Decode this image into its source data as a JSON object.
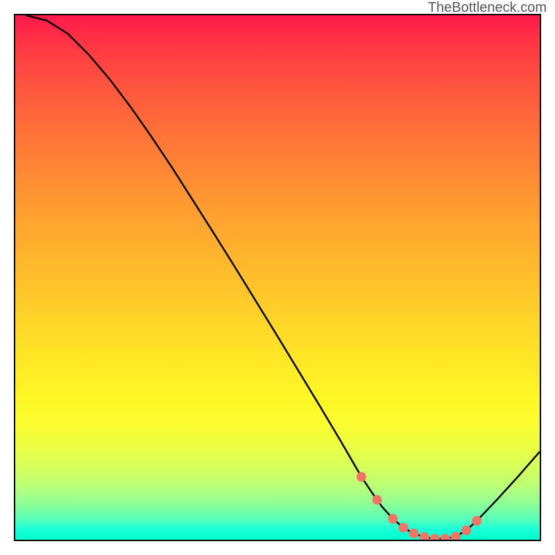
{
  "attribution": "TheBottleneck.com",
  "colors": {
    "border": "#000000",
    "line": "#000000",
    "data_point": "#f07565",
    "gradient_top": "#ff1a4d",
    "gradient_bottom": "#00ffcc"
  },
  "chart_data": {
    "type": "line",
    "title": "",
    "xlabel": "",
    "ylabel": "",
    "xlim": [
      0,
      100
    ],
    "ylim": [
      0,
      100
    ],
    "series": [
      {
        "name": "curve",
        "x": [
          2,
          6,
          10,
          14,
          18,
          22,
          26,
          30,
          34,
          38,
          42,
          46,
          50,
          54,
          58,
          62,
          66,
          68,
          70,
          72,
          74,
          76,
          78,
          80,
          82,
          84,
          86,
          88,
          92,
          96,
          100
        ],
        "y": [
          100,
          99,
          96.5,
          92.5,
          87.8,
          82.5,
          76.8,
          70.8,
          64.5,
          58.2,
          51.8,
          45.3,
          38.8,
          32.2,
          25.6,
          18.9,
          12.0,
          9.0,
          6.2,
          4.0,
          2.3,
          1.2,
          0.5,
          0.2,
          0.2,
          0.6,
          1.8,
          3.6,
          7.8,
          12.2,
          16.8
        ]
      }
    ],
    "data_points": {
      "name": "highlighted-points",
      "x": [
        66,
        69,
        72,
        74,
        76,
        78,
        80,
        82,
        84,
        86,
        88
      ],
      "y": [
        12.0,
        7.6,
        4.0,
        2.3,
        1.2,
        0.5,
        0.2,
        0.2,
        0.6,
        1.8,
        3.6
      ]
    },
    "description": "Bottleneck-style curve with rainbow vertical gradient background. Curve descends from top-left, reaches minimum near x≈80, then rises. Salmon dots mark the valley region."
  }
}
